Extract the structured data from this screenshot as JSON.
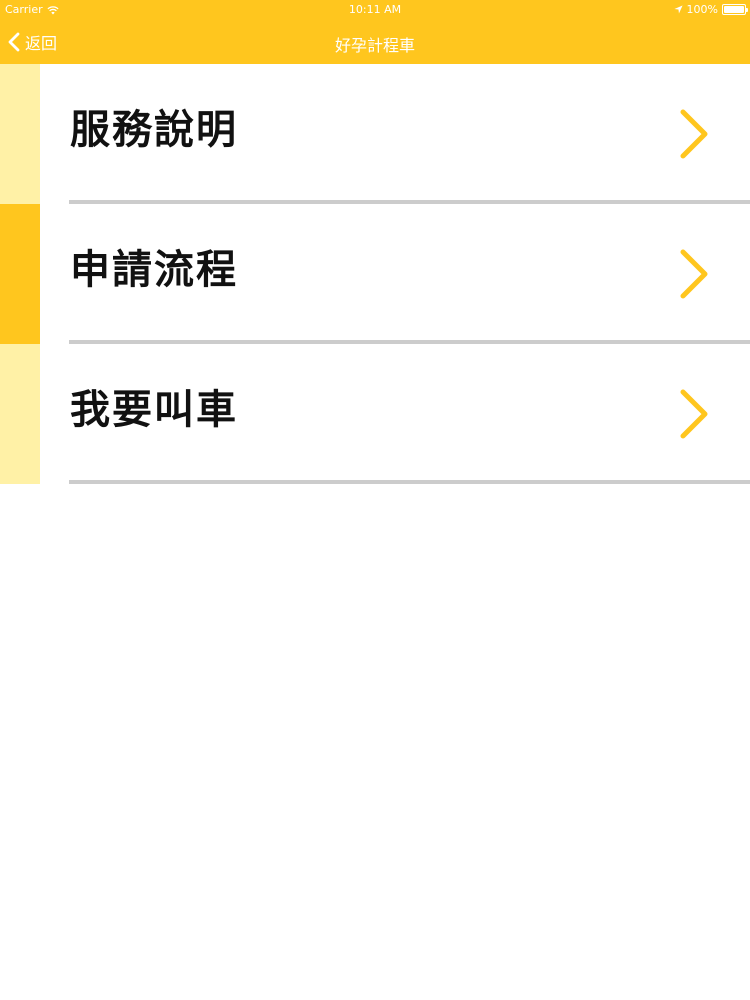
{
  "status_bar": {
    "carrier": "Carrier",
    "time": "10:11 AM",
    "battery_text": "100%",
    "wifi_icon": "wifi-icon",
    "location_icon": "location-arrow-icon",
    "battery_icon": "battery-full-icon"
  },
  "nav_bar": {
    "back_label": "返回",
    "title": "好孕計程車",
    "back_icon": "chevron-left-icon"
  },
  "menu": {
    "items": [
      {
        "label": "服務說明",
        "icon": "chevron-right-icon"
      },
      {
        "label": "申請流程",
        "icon": "chevron-right-icon"
      },
      {
        "label": "我要叫車",
        "icon": "chevron-right-icon"
      }
    ]
  },
  "colors": {
    "brand_yellow": "#FFC61E",
    "light_yellow": "#FFF1A6",
    "divider": "#CCCCCC",
    "text": "#111111"
  }
}
